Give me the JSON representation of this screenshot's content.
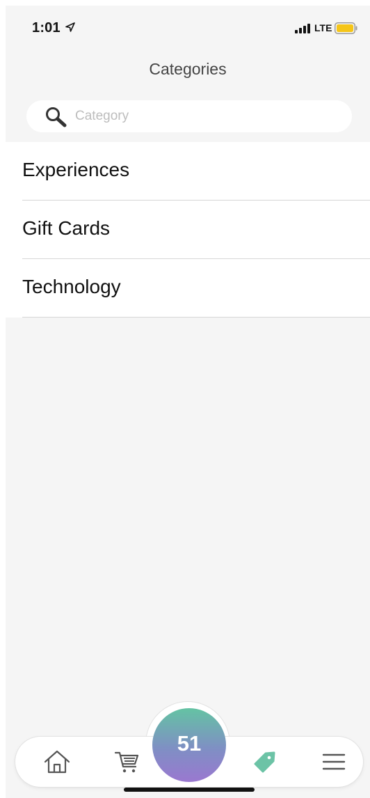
{
  "status_bar": {
    "time": "1:01",
    "network": "LTE",
    "battery_color": "#f5c518"
  },
  "header": {
    "title": "Categories"
  },
  "search": {
    "placeholder": "Category",
    "value": ""
  },
  "categories": [
    {
      "label": "Experiences"
    },
    {
      "label": "Gift Cards"
    },
    {
      "label": "Technology"
    }
  ],
  "bottom_nav": {
    "items": [
      {
        "icon": "home-icon"
      },
      {
        "icon": "cart-icon"
      },
      {
        "icon": "tag-icon"
      },
      {
        "icon": "menu-icon"
      }
    ],
    "points": "51",
    "accent_color": "#6cc3a6"
  }
}
